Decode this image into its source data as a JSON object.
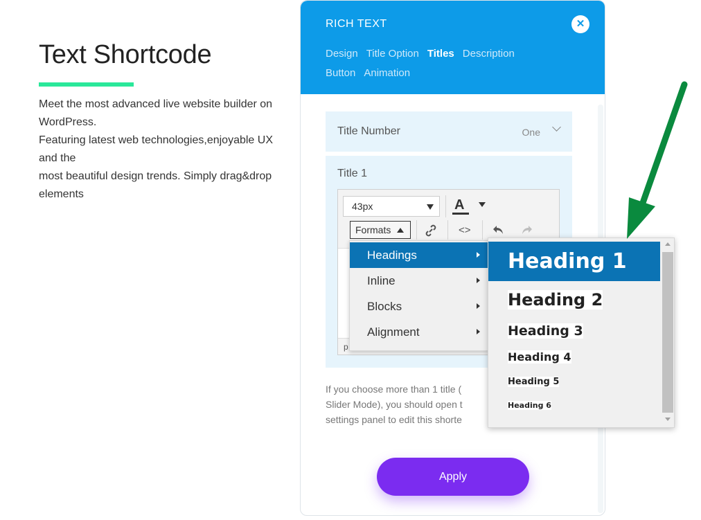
{
  "page": {
    "title": "Text Shortcode",
    "description_lines": [
      "Meet the most advanced live website builder on",
      "WordPress.",
      "Featuring latest web technologies,enjoyable UX",
      "and the",
      "most beautiful design trends. Simply drag&drop",
      "elements"
    ],
    "accent_color": "#2ae89a"
  },
  "panel": {
    "title": "RICH TEXT",
    "header_color": "#0d9be8",
    "close_icon": "close-icon",
    "tabs": [
      {
        "label": "Design",
        "active": false
      },
      {
        "label": "Title Option",
        "active": false
      },
      {
        "label": "Titles",
        "active": true
      },
      {
        "label": "Description",
        "active": false
      },
      {
        "label": "Button",
        "active": false
      },
      {
        "label": "Animation",
        "active": false
      }
    ],
    "title_number": {
      "label": "Title Number",
      "value": "One"
    },
    "title1": {
      "label": "Title 1",
      "font_size": "43px",
      "formats_label": "Formats",
      "status_text": "p"
    },
    "help_text_lines": [
      "If you choose more than 1 title (",
      "Slider Mode), you should open t",
      "settings panel to edit this shorte"
    ],
    "apply_label": "Apply",
    "apply_color": "#7b2cf0"
  },
  "format_menu": {
    "items": [
      {
        "label": "Headings",
        "active": true
      },
      {
        "label": "Inline",
        "active": false
      },
      {
        "label": "Blocks",
        "active": false
      },
      {
        "label": "Alignment",
        "active": false
      }
    ]
  },
  "headings_menu": {
    "items": [
      {
        "label": "Heading 1",
        "active": true
      },
      {
        "label": "Heading 2",
        "active": false
      },
      {
        "label": "Heading 3",
        "active": false
      },
      {
        "label": "Heading 4",
        "active": false
      },
      {
        "label": "Heading 5",
        "active": false
      },
      {
        "label": "Heading 6",
        "active": false
      }
    ]
  },
  "annotation": {
    "arrow_color": "#0a8a3e"
  }
}
